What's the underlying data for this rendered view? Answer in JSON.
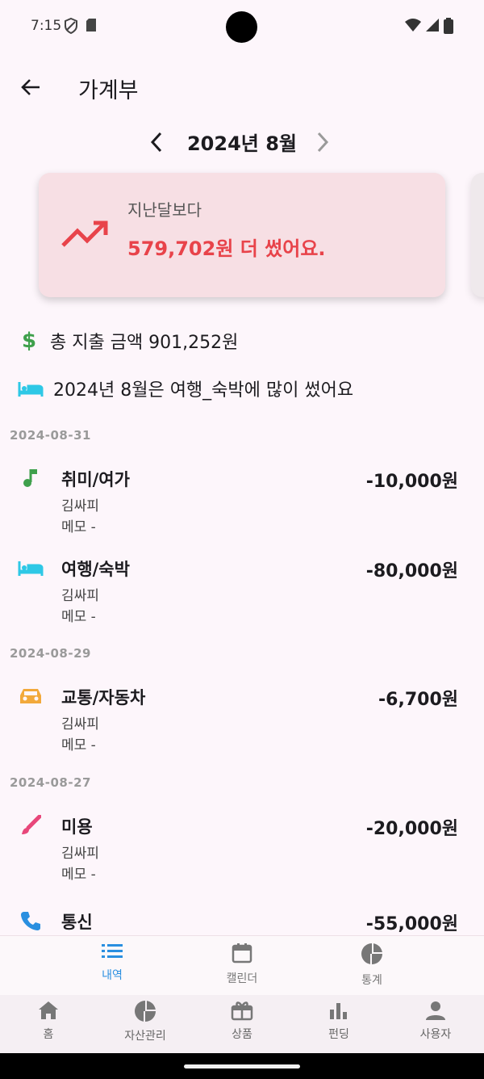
{
  "status": {
    "time": "7:15"
  },
  "header": {
    "title": "가계부"
  },
  "month_nav": {
    "label": "2024년 8월"
  },
  "compare_card": {
    "title": "지난달보다",
    "value": "579,702원 더 썼어요."
  },
  "summary": {
    "total": "총 지출 금액  901,252원",
    "top_category": "2024년 8월은 여행_숙박에 많이 썼어요"
  },
  "groups": [
    {
      "date": "2024-08-31",
      "items": [
        {
          "category": "취미/여가",
          "user": "김싸피",
          "memo": "메모 -",
          "amount": "-10,000원",
          "icon": "music-note-icon",
          "color": "#3fa04c"
        },
        {
          "category": "여행/숙박",
          "user": "김싸피",
          "memo": "메모 -",
          "amount": "-80,000원",
          "icon": "bed-icon",
          "color": "#2ec8e6"
        }
      ]
    },
    {
      "date": "2024-08-29",
      "items": [
        {
          "category": "교통/자동차",
          "user": "김싸피",
          "memo": "메모 -",
          "amount": "-6,700원",
          "icon": "car-icon",
          "color": "#f2a93b"
        }
      ]
    },
    {
      "date": "2024-08-27",
      "items": [
        {
          "category": "미용",
          "user": "김싸피",
          "memo": "메모 -",
          "amount": "-20,000원",
          "icon": "brush-icon",
          "color": "#e8477a"
        },
        {
          "category": "통신",
          "user": "",
          "memo": "",
          "amount": "-55,000원",
          "icon": "phone-icon",
          "color": "#2a8fe0"
        }
      ]
    }
  ],
  "sub_tabs": [
    {
      "label": "내역",
      "icon": "list-icon",
      "active": true
    },
    {
      "label": "캘린더",
      "icon": "calendar-icon",
      "active": false
    },
    {
      "label": "통계",
      "icon": "pie-chart-icon",
      "active": false
    }
  ],
  "bottom_nav": [
    {
      "label": "홈",
      "icon": "home-icon"
    },
    {
      "label": "자산관리",
      "icon": "pie-chart-icon"
    },
    {
      "label": "상품",
      "icon": "gift-icon"
    },
    {
      "label": "펀딩",
      "icon": "bar-chart-icon"
    },
    {
      "label": "사용자",
      "icon": "person-icon"
    }
  ],
  "colors": {
    "accent": "#2a8fe0",
    "warning": "#e8434a",
    "card_bg": "#f7dfe4"
  }
}
